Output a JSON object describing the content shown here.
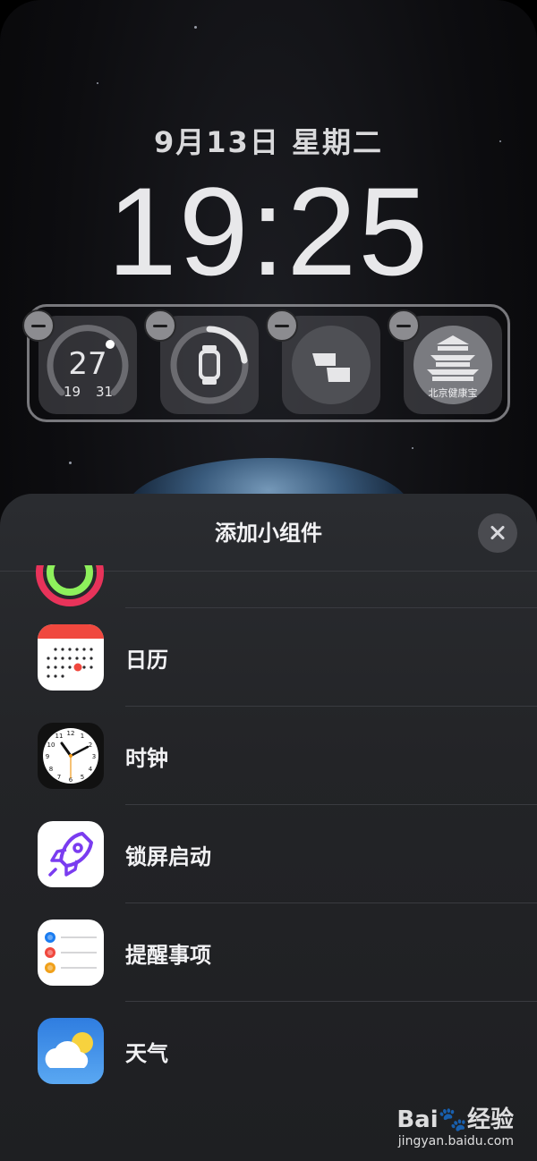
{
  "lockscreen": {
    "date": "9月13日 星期二",
    "time": "19:25",
    "widgets": [
      {
        "name": "temperature",
        "value": "27",
        "low": "19",
        "high": "31"
      },
      {
        "name": "watch-battery"
      },
      {
        "name": "shortcut"
      },
      {
        "name": "beijing-health",
        "label": "北京健康宝"
      }
    ]
  },
  "sheet": {
    "title": "添加小组件",
    "items": [
      {
        "label": "日历",
        "icon": "calendar-icon"
      },
      {
        "label": "时钟",
        "icon": "clock-icon"
      },
      {
        "label": "锁屏启动",
        "icon": "rocket-icon"
      },
      {
        "label": "提醒事项",
        "icon": "reminders-icon"
      },
      {
        "label": "天气",
        "icon": "weather-icon"
      }
    ]
  },
  "watermark": {
    "brand": "Bai",
    "brand2": "经验",
    "url": "jingyan.baidu.com"
  }
}
